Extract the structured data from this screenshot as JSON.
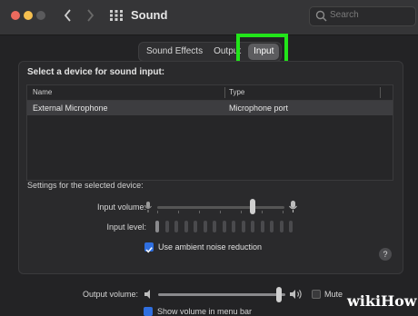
{
  "window": {
    "title": "Sound",
    "search_placeholder": "Search"
  },
  "tabs": [
    {
      "label": "Sound Effects",
      "selected": false
    },
    {
      "label": "Output",
      "selected": false
    },
    {
      "label": "Input",
      "selected": true
    }
  ],
  "input_panel": {
    "heading": "Select a device for sound input:",
    "columns": {
      "name": "Name",
      "type": "Type"
    },
    "devices": [
      {
        "name": "External Microphone",
        "type": "Microphone port",
        "selected": true
      }
    ],
    "settings_label": "Settings for the selected device:",
    "input_volume_label": "Input volume:",
    "input_volume_fraction": 0.75,
    "input_level_label": "Input level:",
    "input_level_lit_bars": 1,
    "ambient_noise_label": "Use ambient noise reduction",
    "ambient_noise_checked": true,
    "help_label": "?"
  },
  "output": {
    "volume_label": "Output volume:",
    "volume_fraction": 0.95,
    "mute_label": "Mute",
    "mute_checked": false,
    "menubar_label": "Show volume in menu bar",
    "menubar_checked": true
  },
  "watermark": {
    "part1": "wiki",
    "part2": "How"
  },
  "colors": {
    "highlight": "#22e51a",
    "accent": "#2f6fe0",
    "background": "#232325"
  }
}
